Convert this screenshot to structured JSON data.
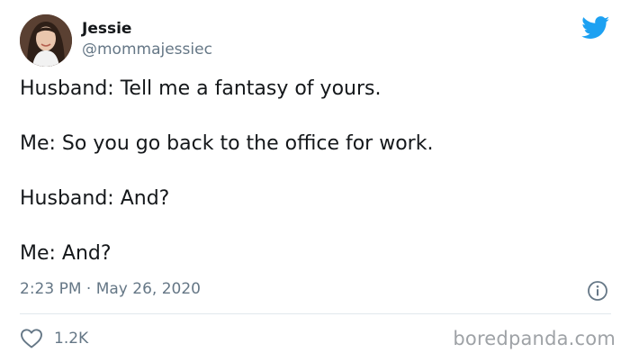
{
  "author": {
    "name": "Jessie",
    "handle": "@mommajessiec",
    "avatar_icon": "profile-photo"
  },
  "tweet": {
    "lines": [
      "Husband: Tell me a fantasy of yours.",
      "Me: So you go back to the office for work.",
      "Husband: And?",
      "Me: And?"
    ],
    "timestamp": "2:23 PM · May 26, 2020"
  },
  "actions": {
    "like_icon": "heart-outline",
    "like_count": "1.2K",
    "info_icon": "info-circle"
  },
  "brand": {
    "icon": "twitter-bird",
    "color": "#1da1f2"
  },
  "watermark": "boredpanda.com",
  "colors": {
    "text": "#14171a",
    "secondary": "#657786",
    "divider": "#e1e8ed",
    "watermark": "#9ea2a6"
  }
}
